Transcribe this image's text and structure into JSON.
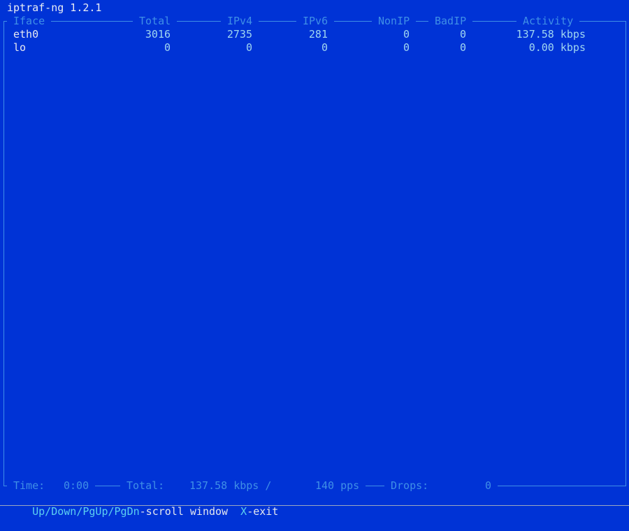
{
  "app": {
    "title": "iptraf-ng 1.2.1"
  },
  "colors": {
    "background": "#0033d6",
    "header": "#3f8fe6",
    "iface_text": "#e6e8f0",
    "number_text": "#9fd6f0",
    "key_text": "#5cd0f0"
  },
  "table": {
    "columns": [
      "Iface",
      "Total",
      "IPv4",
      "IPv6",
      "NonIP",
      "BadIP",
      "Activity"
    ],
    "rows": [
      {
        "iface": "eth0",
        "total": "3016",
        "ipv4": "2735",
        "ipv6": "281",
        "nonip": "0",
        "badip": "0",
        "activity": "137.58 kbps"
      },
      {
        "iface": "lo",
        "total": "0",
        "ipv4": "0",
        "ipv6": "0",
        "nonip": "0",
        "badip": "0",
        "activity": "0.00 kbps"
      }
    ]
  },
  "status": {
    "time_label": "Time:",
    "time_value": "0:00",
    "total_label": "Total:",
    "total_rate": "137.58 kbps /",
    "total_pps": "140 pps",
    "drops_label": "Drops:",
    "drops_value": "0"
  },
  "keys": [
    {
      "key": "Up/Down/PgUp/PgDn",
      "desc": "-scroll window"
    },
    {
      "key": "X",
      "desc": "-exit"
    }
  ]
}
